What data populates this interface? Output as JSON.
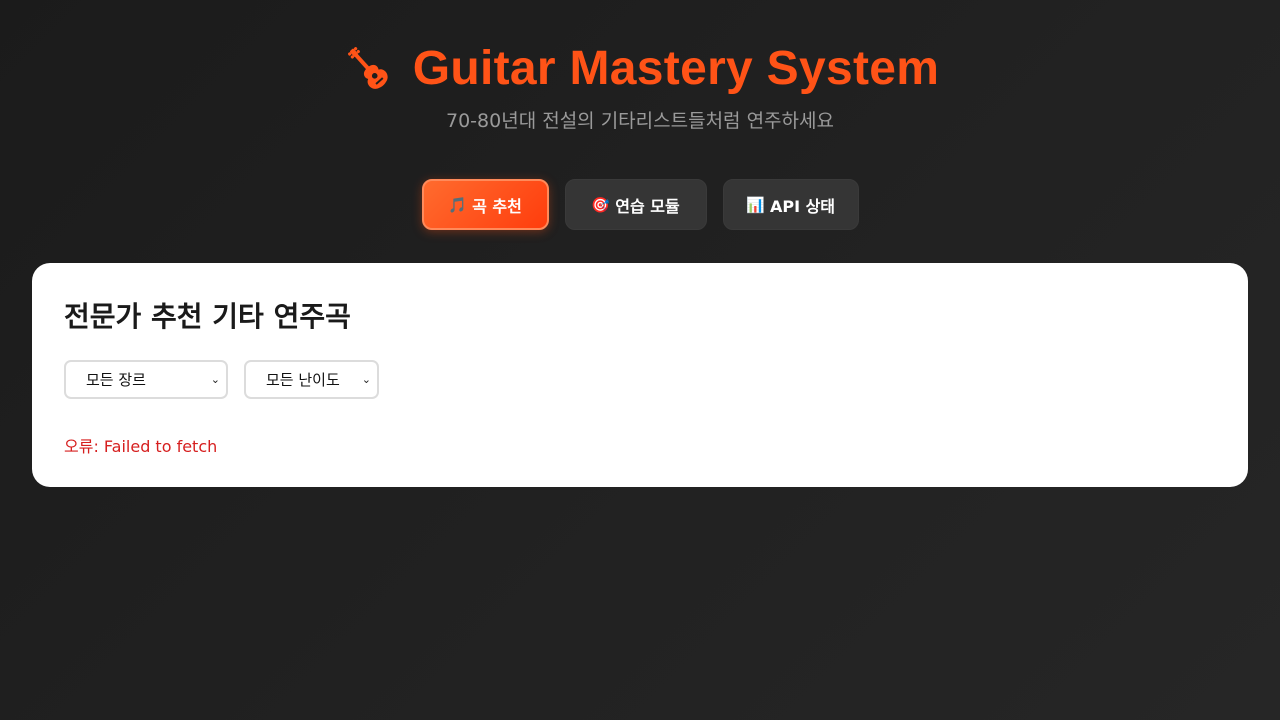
{
  "header": {
    "title": "Guitar Mastery System",
    "subtitle": "70-80년대 전설의 기타리스트들처럼 연주하세요",
    "icon": "guitar-icon"
  },
  "tabs": [
    {
      "icon": "🎵",
      "label": "곡 추천",
      "active": true
    },
    {
      "icon": "🎯",
      "label": "연습 모듈",
      "active": false
    },
    {
      "icon": "📊",
      "label": "API 상태",
      "active": false
    }
  ],
  "main": {
    "title": "전문가 추천 기타 연주곡",
    "filters": {
      "genre": {
        "selected": "모든 장르"
      },
      "difficulty": {
        "selected": "모든 난이도"
      }
    },
    "error": "오류: Failed to fetch"
  },
  "colors": {
    "accent": "#ff5317",
    "error": "#d61f1f",
    "background": "#1f1f1f"
  }
}
